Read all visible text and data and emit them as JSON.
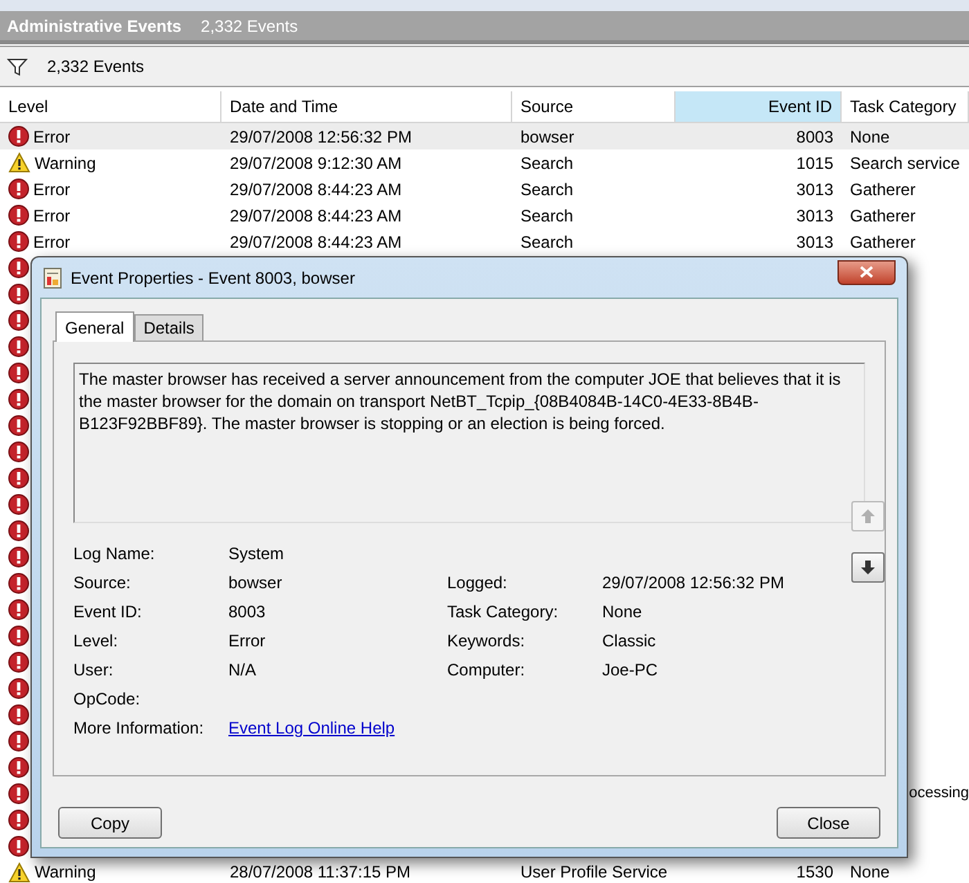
{
  "panel": {
    "title": "Administrative Events",
    "count": "2,332 Events"
  },
  "filter_bar": {
    "count": "2,332 Events"
  },
  "table": {
    "columns": [
      {
        "label": "Level",
        "selected": false
      },
      {
        "label": "Date and Time",
        "selected": false
      },
      {
        "label": "Source",
        "selected": false
      },
      {
        "label": "Event ID",
        "selected": true
      },
      {
        "label": "Task Category",
        "selected": false
      }
    ],
    "rows": [
      {
        "kind": "error",
        "level_text": "Error",
        "date": "29/07/2008 12:56:32 PM",
        "source": "bowser",
        "event_id": "8003",
        "task_category": "None",
        "selected": true
      },
      {
        "kind": "warning",
        "level_text": "Warning",
        "date": "29/07/2008 9:12:30 AM",
        "source": "Search",
        "event_id": "1015",
        "task_category": "Search service",
        "selected": false
      },
      {
        "kind": "error",
        "level_text": "Error",
        "date": "29/07/2008 8:44:23 AM",
        "source": "Search",
        "event_id": "3013",
        "task_category": "Gatherer",
        "selected": false
      },
      {
        "kind": "error",
        "level_text": "Error",
        "date": "29/07/2008 8:44:23 AM",
        "source": "Search",
        "event_id": "3013",
        "task_category": "Gatherer",
        "selected": false
      },
      {
        "kind": "error",
        "level_text": "Error",
        "date": "29/07/2008 8:44:23 AM",
        "source": "Search",
        "event_id": "3013",
        "task_category": "Gatherer",
        "selected": false
      },
      {
        "kind": "error",
        "selected": false
      },
      {
        "kind": "error",
        "selected": false
      },
      {
        "kind": "error",
        "selected": false
      },
      {
        "kind": "error",
        "selected": false
      },
      {
        "kind": "error",
        "selected": false
      },
      {
        "kind": "error",
        "selected": false
      },
      {
        "kind": "error",
        "selected": false
      },
      {
        "kind": "error",
        "selected": false
      },
      {
        "kind": "error",
        "selected": false
      },
      {
        "kind": "error",
        "selected": false
      },
      {
        "kind": "error",
        "selected": false
      },
      {
        "kind": "error",
        "selected": false
      },
      {
        "kind": "error",
        "selected": false
      },
      {
        "kind": "error",
        "selected": false
      },
      {
        "kind": "error",
        "selected": false
      },
      {
        "kind": "error",
        "selected": false
      },
      {
        "kind": "error",
        "selected": false
      },
      {
        "kind": "error",
        "selected": false
      },
      {
        "kind": "error",
        "selected": false
      },
      {
        "kind": "error",
        "selected": false
      },
      {
        "kind": "error",
        "task_category": "ocessing",
        "selected": false
      },
      {
        "kind": "error",
        "selected": false
      },
      {
        "kind": "error",
        "selected": false
      },
      {
        "kind": "warning",
        "level_text": "Warning",
        "date": "28/07/2008 11:37:15 PM",
        "source": "User Profile Service",
        "event_id": "1530",
        "task_category": "None",
        "selected": false
      }
    ]
  },
  "dialog": {
    "title": "Event Properties - Event 8003, bowser",
    "tabs": [
      {
        "label": "General",
        "selected": true
      },
      {
        "label": "Details",
        "selected": false
      }
    ],
    "description": "The master browser has received a server announcement from the computer JOE that believes that it is the master browser for the domain on transport NetBT_Tcpip_{08B4084B-14C0-4E33-8B4B-B123F92BBF89}. The master browser is stopping or an election is being forced.",
    "fields": [
      {
        "label": "Log Name:",
        "value": "System"
      },
      {
        "label": "Source:",
        "value": "bowser",
        "right": {
          "label": "Logged:",
          "value": "29/07/2008 12:56:32 PM"
        }
      },
      {
        "label": "Event ID:",
        "value": "8003",
        "right": {
          "label": "Task Category:",
          "value": "None"
        }
      },
      {
        "label": "Level:",
        "value": "Error",
        "right": {
          "label": "Keywords:",
          "value": "Classic"
        }
      },
      {
        "label": "User:",
        "value": "N/A",
        "right": {
          "label": "Computer:",
          "value": "Joe-PC"
        }
      },
      {
        "label": "OpCode:"
      },
      {
        "label": "More Information:",
        "link": "Event Log Online Help"
      }
    ],
    "nav_buttons": [
      {
        "kind": "up",
        "disabled": true
      },
      {
        "kind": "down",
        "disabled": false
      }
    ],
    "buttons": [
      "Copy",
      "Close"
    ]
  }
}
